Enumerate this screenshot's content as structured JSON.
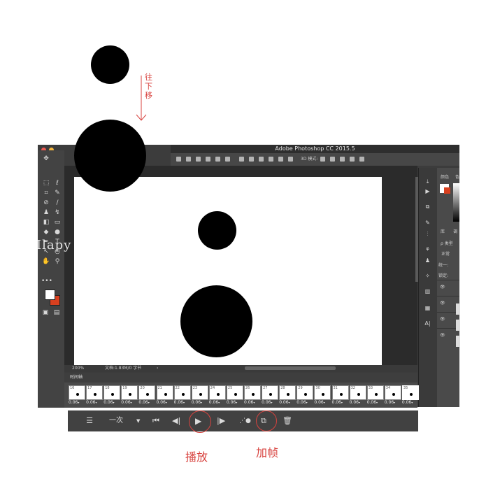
{
  "window": {
    "title": "Adobe Photoshop CC 2015.5",
    "options_text": "3D 模式:"
  },
  "traffic_lights": [
    "#ee5a52",
    "#f5b73f"
  ],
  "toolbar": {
    "tools": [
      {
        "icon": "move-icon",
        "glyph": "✥"
      },
      {
        "icon": "marquee-icon",
        "glyph": "⬚"
      },
      {
        "icon": "lasso-icon",
        "glyph": "ℓ"
      },
      {
        "icon": "crop-icon",
        "glyph": "⌗"
      },
      {
        "icon": "eyedropper-icon",
        "glyph": "✎"
      },
      {
        "icon": "healing-icon",
        "glyph": "⊘"
      },
      {
        "icon": "brush-icon",
        "glyph": "/"
      },
      {
        "icon": "stamp-icon",
        "glyph": "♟"
      },
      {
        "icon": "history-brush-icon",
        "glyph": "↯"
      },
      {
        "icon": "eraser-icon",
        "glyph": "◧"
      },
      {
        "icon": "gradient-icon",
        "glyph": "▭"
      },
      {
        "icon": "blur-icon",
        "glyph": "◆"
      },
      {
        "icon": "dodge-icon",
        "glyph": "●"
      },
      {
        "icon": "pen-icon",
        "glyph": "✒"
      },
      {
        "icon": "type-icon",
        "glyph": "T"
      },
      {
        "icon": "path-select-icon",
        "glyph": "↖"
      },
      {
        "icon": "ellipse-icon",
        "glyph": "○"
      },
      {
        "icon": "hand-icon",
        "glyph": "✋"
      },
      {
        "icon": "zoom-icon",
        "glyph": "⚲"
      },
      {
        "icon": "more-icon",
        "glyph": "•••"
      }
    ],
    "foreground_color": "#ffffff",
    "background_color": "#d8401f"
  },
  "status": {
    "zoom": "200%",
    "doc_info": "文档:1.83M/0 字节",
    "arrow": "›"
  },
  "right_panel": {
    "color_tab": "颜色",
    "color_tab2": "色",
    "tab_a": "库",
    "tab_b": "调",
    "kind_filter": "ρ 类型",
    "blend_mode": "正常",
    "unify": "统一:",
    "lock": "锁定:"
  },
  "timeline": {
    "title": "时间轴",
    "frames": [
      {
        "num": "16",
        "delay": "0.06"
      },
      {
        "num": "17",
        "delay": "0.06"
      },
      {
        "num": "18",
        "delay": "0.06"
      },
      {
        "num": "19",
        "delay": "0.06"
      },
      {
        "num": "20",
        "delay": "0.06"
      },
      {
        "num": "21",
        "delay": "0.06"
      },
      {
        "num": "22",
        "delay": "0.06"
      },
      {
        "num": "23",
        "delay": "0.06"
      },
      {
        "num": "24",
        "delay": "0.06"
      },
      {
        "num": "25",
        "delay": "0.06"
      },
      {
        "num": "26",
        "delay": "0.06"
      },
      {
        "num": "27",
        "delay": "0.06"
      },
      {
        "num": "28",
        "delay": "0.06"
      },
      {
        "num": "29",
        "delay": "0.06"
      },
      {
        "num": "30",
        "delay": "0.06"
      },
      {
        "num": "31",
        "delay": "0.06"
      },
      {
        "num": "32",
        "delay": "0.06"
      },
      {
        "num": "33",
        "delay": "0.06"
      },
      {
        "num": "34",
        "delay": "0.06"
      },
      {
        "num": "35",
        "delay": "0.06"
      }
    ],
    "delay_arrow": "▾",
    "loop_label": "一次",
    "loop_arrow": "▼"
  },
  "annotations": {
    "move_down": "往下移",
    "play": "播放",
    "add_frame": "加帧",
    "accent_color": "#d8433f"
  },
  "watermark": "Ilapy"
}
